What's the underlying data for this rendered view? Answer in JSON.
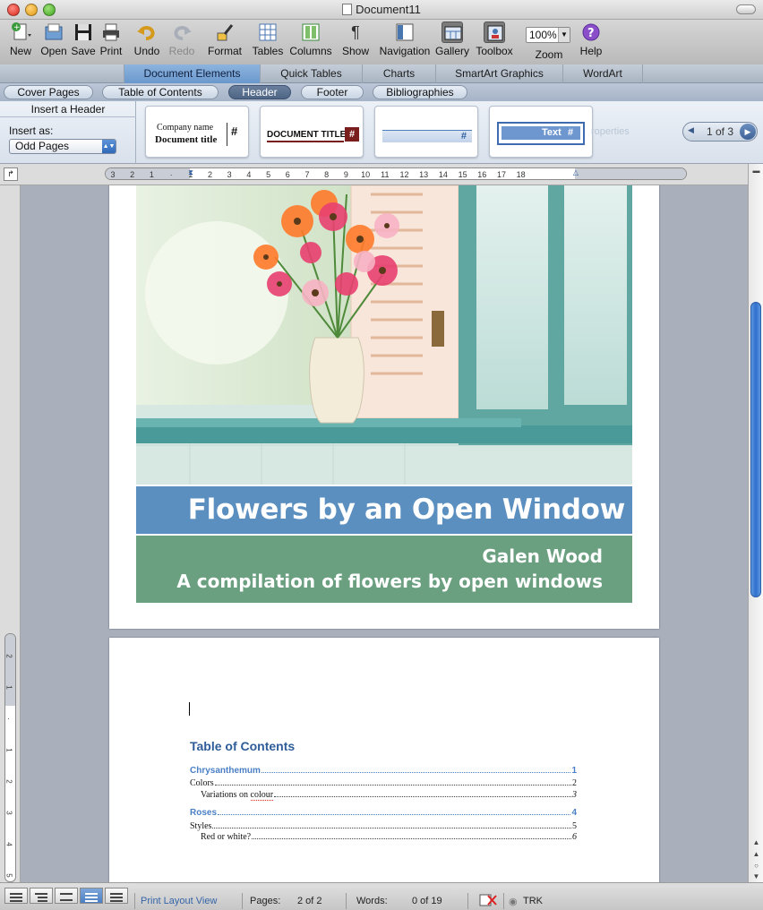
{
  "window": {
    "title": "Document11"
  },
  "toolbar": {
    "items": [
      {
        "label": "New",
        "icon": "new-document-icon"
      },
      {
        "label": "Open",
        "icon": "open-folder-icon"
      },
      {
        "label": "Save",
        "icon": "save-icon"
      },
      {
        "label": "Print",
        "icon": "print-icon"
      },
      {
        "label": "Undo",
        "icon": "undo-icon"
      },
      {
        "label": "Redo",
        "icon": "redo-icon",
        "disabled": true
      },
      {
        "label": "Format",
        "icon": "format-brush-icon"
      },
      {
        "label": "Tables",
        "icon": "tables-icon"
      },
      {
        "label": "Columns",
        "icon": "columns-icon"
      },
      {
        "label": "Show",
        "icon": "pilcrow-icon"
      },
      {
        "label": "Navigation",
        "icon": "navigation-icon"
      },
      {
        "label": "Gallery",
        "icon": "gallery-icon",
        "pressed": true
      },
      {
        "label": "Toolbox",
        "icon": "toolbox-icon",
        "pressed": true
      },
      {
        "label": "Zoom",
        "icon": "zoom-icon"
      },
      {
        "label": "Help",
        "icon": "help-icon"
      }
    ],
    "zoom_value": "100%"
  },
  "ribbon": {
    "tabs": [
      "Document Elements",
      "Quick Tables",
      "Charts",
      "SmartArt Graphics",
      "WordArt"
    ],
    "active_tab": "Document Elements",
    "subtabs": [
      "Cover Pages",
      "Table of Contents",
      "Header",
      "Footer",
      "Bibliographies"
    ],
    "active_subtab": "Header"
  },
  "gallery": {
    "panel_title": "Insert a Header",
    "insert_as_label": "Insert as:",
    "insert_as_value": "Odd Pages",
    "thumb1": {
      "company": "Company name",
      "doc": "Document title",
      "hash": "#"
    },
    "thumb2": {
      "title": "DOCUMENT TITLE",
      "hash": "#"
    },
    "thumb3": {
      "hash": "#"
    },
    "thumb4": {
      "text": "Text",
      "hash": "#"
    },
    "ghost_text": "roperties",
    "pager": "1 of 3"
  },
  "ruler": {
    "ticks": [
      "3",
      "2",
      "1",
      "",
      "1",
      "2",
      "3",
      "4",
      "5",
      "6",
      "7",
      "8",
      "9",
      "10",
      "11",
      "12",
      "13",
      "14",
      "15",
      "16",
      "17",
      "18"
    ]
  },
  "vruler": {
    "ticks": [
      "2",
      "1",
      "",
      "1",
      "2",
      "3",
      "4",
      "5"
    ]
  },
  "cover": {
    "title": "Flowers by an Open Window",
    "author": "Galen Wood",
    "subtitle": "A compilation of flowers by open windows"
  },
  "toc": {
    "heading": "Table of Contents",
    "entries": [
      {
        "text": "Chrysanthemum",
        "page": "1",
        "level": 1
      },
      {
        "text": "Colors",
        "page": "2",
        "level": 2
      },
      {
        "text": "Variations on ",
        "text_flag": "colour",
        "page": "3",
        "level": 3
      },
      {
        "text": "Roses",
        "page": "4",
        "level": 1
      },
      {
        "text": "Styles",
        "page": "5",
        "level": 2
      },
      {
        "text": "Red or white?",
        "page": "6",
        "level": 3
      }
    ]
  },
  "status": {
    "view": "Print Layout View",
    "pages_label": "Pages:",
    "pages_value": "2 of 2",
    "words_label": "Words:",
    "words_value": "0 of 19",
    "trk": "TRK"
  },
  "colors": {
    "title_band": "#5b8fc0",
    "author_band": "#6a9f80",
    "toc_heading": "#2e5d99",
    "toc_level1": "#4a7fc6"
  }
}
